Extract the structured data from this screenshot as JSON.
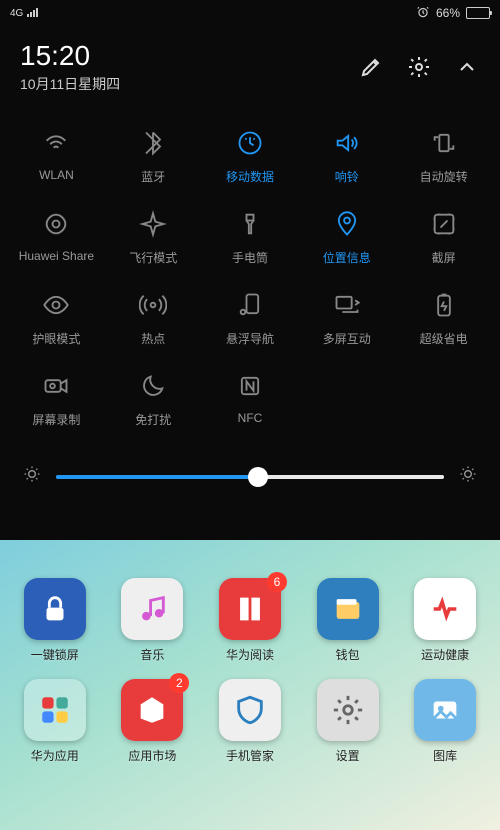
{
  "status": {
    "signal": "4G",
    "alarm_icon": "alarm",
    "battery_pct": "66%"
  },
  "header": {
    "time": "15:20",
    "date": "10月11日星期四"
  },
  "tiles": [
    {
      "id": "wlan",
      "label": "WLAN",
      "icon": "wifi",
      "active": false
    },
    {
      "id": "bluetooth",
      "label": "蓝牙",
      "icon": "bluetooth",
      "active": false
    },
    {
      "id": "mobile-data",
      "label": "移动数据",
      "icon": "data",
      "active": true
    },
    {
      "id": "sound",
      "label": "响铃",
      "icon": "volume",
      "active": true
    },
    {
      "id": "autorotate",
      "label": "自动旋转",
      "icon": "rotate",
      "active": false
    },
    {
      "id": "huawei-share",
      "label": "Huawei Share",
      "icon": "share",
      "active": false
    },
    {
      "id": "airplane",
      "label": "飞行模式",
      "icon": "plane",
      "active": false
    },
    {
      "id": "flashlight",
      "label": "手电筒",
      "icon": "torch",
      "active": false
    },
    {
      "id": "location",
      "label": "位置信息",
      "icon": "pin",
      "active": true
    },
    {
      "id": "screenshot",
      "label": "截屏",
      "icon": "screenshot",
      "active": false
    },
    {
      "id": "eyecare",
      "label": "护眼模式",
      "icon": "eye",
      "active": false
    },
    {
      "id": "hotspot",
      "label": "热点",
      "icon": "hotspot",
      "active": false
    },
    {
      "id": "floatnav",
      "label": "悬浮导航",
      "icon": "float",
      "active": false
    },
    {
      "id": "multiscreen",
      "label": "多屏互动",
      "icon": "cast",
      "active": false
    },
    {
      "id": "powersave",
      "label": "超级省电",
      "icon": "battery",
      "active": false
    },
    {
      "id": "screenrec",
      "label": "屏幕录制",
      "icon": "record",
      "active": false
    },
    {
      "id": "dnd",
      "label": "免打扰",
      "icon": "moon",
      "active": false
    },
    {
      "id": "nfc",
      "label": "NFC",
      "icon": "nfc",
      "active": false
    }
  ],
  "brightness": {
    "percent": 52
  },
  "home_apps_row1": [
    {
      "label": "一键锁屏",
      "icon": "lock",
      "bg": "#2b5fb8"
    },
    {
      "label": "音乐",
      "icon": "music",
      "bg": "#efefef"
    },
    {
      "label": "华为阅读",
      "icon": "book",
      "bg": "#e83c3c",
      "badge": "6"
    },
    {
      "label": "钱包",
      "icon": "wallet",
      "bg": "#2f7fbf"
    },
    {
      "label": "运动健康",
      "icon": "heart",
      "bg": "#ffffff"
    }
  ],
  "home_apps_row2": [
    {
      "label": "华为应用",
      "icon": "folder",
      "bg": "rgba(255,255,255,0.3)"
    },
    {
      "label": "应用市场",
      "icon": "store",
      "bg": "#e83c3c",
      "badge": "2"
    },
    {
      "label": "手机管家",
      "icon": "shield",
      "bg": "#efefef"
    },
    {
      "label": "设置",
      "icon": "gear",
      "bg": "#dedede"
    },
    {
      "label": "图库",
      "icon": "gallery",
      "bg": "#6fb8e8"
    }
  ]
}
